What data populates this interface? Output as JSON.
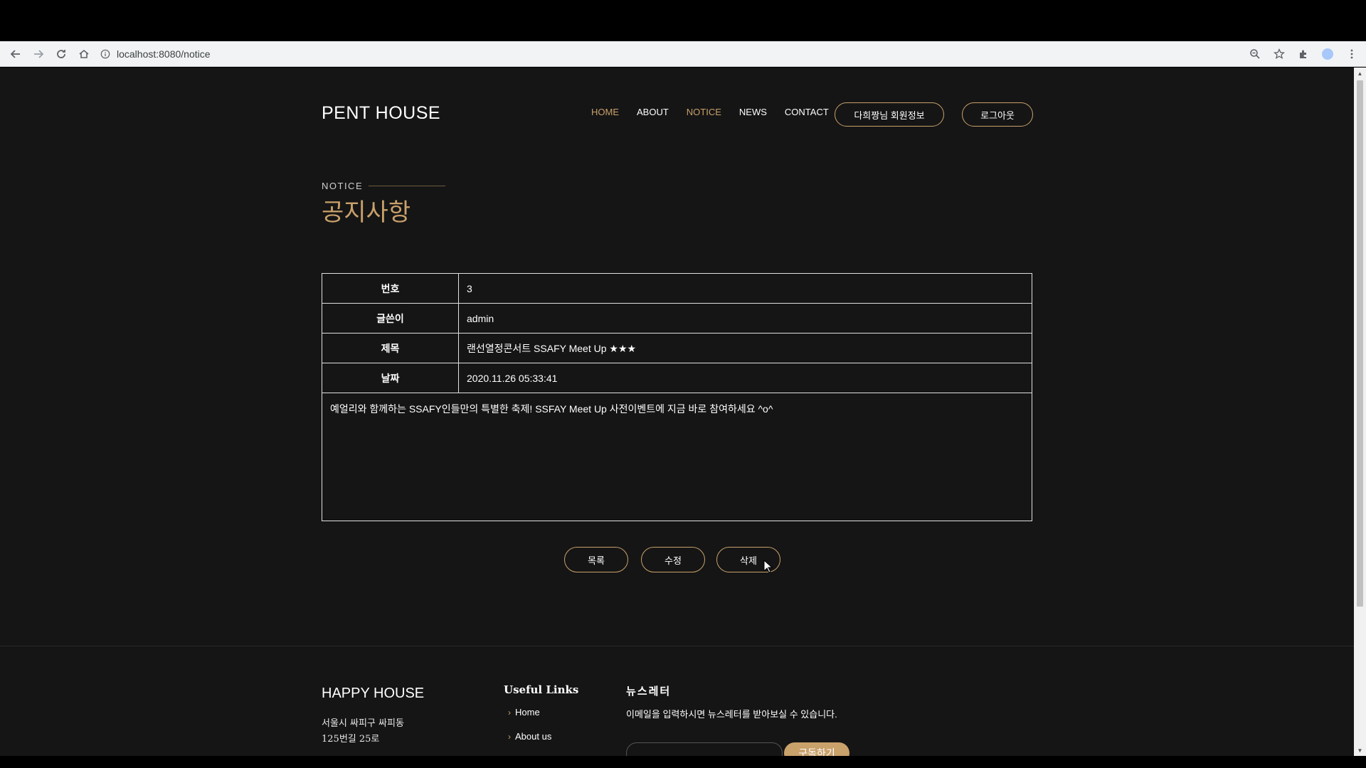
{
  "browser": {
    "url": "localhost:8080/notice"
  },
  "header": {
    "logo": "PENT HOUSE",
    "nav": [
      "HOME",
      "ABOUT",
      "NOTICE",
      "NEWS",
      "CONTACT"
    ],
    "active_nav": "NOTICE",
    "user_info_button": "다희짱님 회원정보",
    "logout_button": "로그아웃"
  },
  "section": {
    "subtitle": "NOTICE",
    "title": "공지사항"
  },
  "notice": {
    "labels": {
      "number": "번호",
      "writer": "글쓴이",
      "subject": "제목",
      "date": "날짜"
    },
    "number": "3",
    "writer": "admin",
    "subject": "랜선열정콘서트 SSAFY Meet Up ★★★",
    "date": "2020.11.26 05:33:41",
    "content": "예얼리와 함께하는 SSAFY인들만의 특별한 축제! SSFAY Meet Up 사전이벤트에 지금 바로 참여하세요 ^o^"
  },
  "actions": {
    "list": "목록",
    "edit": "수정",
    "delete": "삭제"
  },
  "footer": {
    "logo": "HAPPY HOUSE",
    "address_line1": "서울시 싸피구 싸피동",
    "address_line2": "125번길 25로",
    "links_title": "Useful Links",
    "links": [
      "Home",
      "About us"
    ],
    "newsletter_title": "뉴스레터",
    "newsletter_desc": "이메일을 입력하시면 뉴스레터를 받아보실 수 있습니다.",
    "subscribe_button": "구독하기"
  },
  "colors": {
    "accent": "#c9a16b",
    "page_bg": "#151515",
    "text": "#ffffff"
  }
}
